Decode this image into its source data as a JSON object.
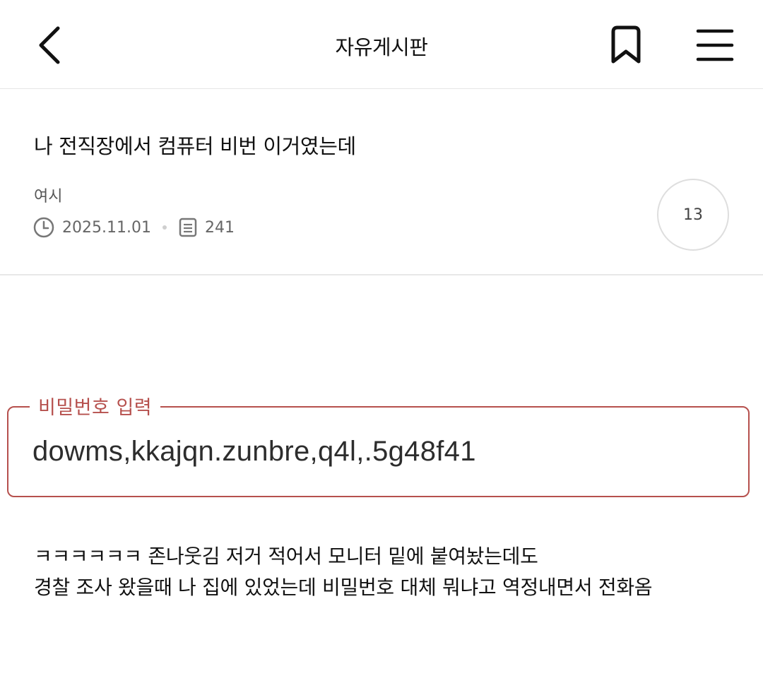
{
  "header": {
    "title": "자유게시판",
    "back_icon": "chevron-left-icon",
    "bookmark_icon": "bookmark-icon",
    "menu_icon": "hamburger-menu-icon"
  },
  "post": {
    "title": "나 전직장에서 컴퓨터 비번 이거였는데",
    "author": "여시",
    "date": "2025.11.01",
    "views": "241",
    "comment_count": "13"
  },
  "password_field": {
    "label": "비밀번호 입력",
    "value": "dowms,kkajqn.zunbre,q4l,.5g48f41",
    "accent_color": "#b6504d"
  },
  "body": {
    "lines": [
      "ㅋㅋㅋㅋㅋㅋ 존나웃김 저거 적어서 모니터 밑에 붙여놨는데도",
      "경찰 조사 왔을때 나 집에 있었는데 비밀번호 대체 뭐냐고 역정내면서 전화옴"
    ]
  }
}
